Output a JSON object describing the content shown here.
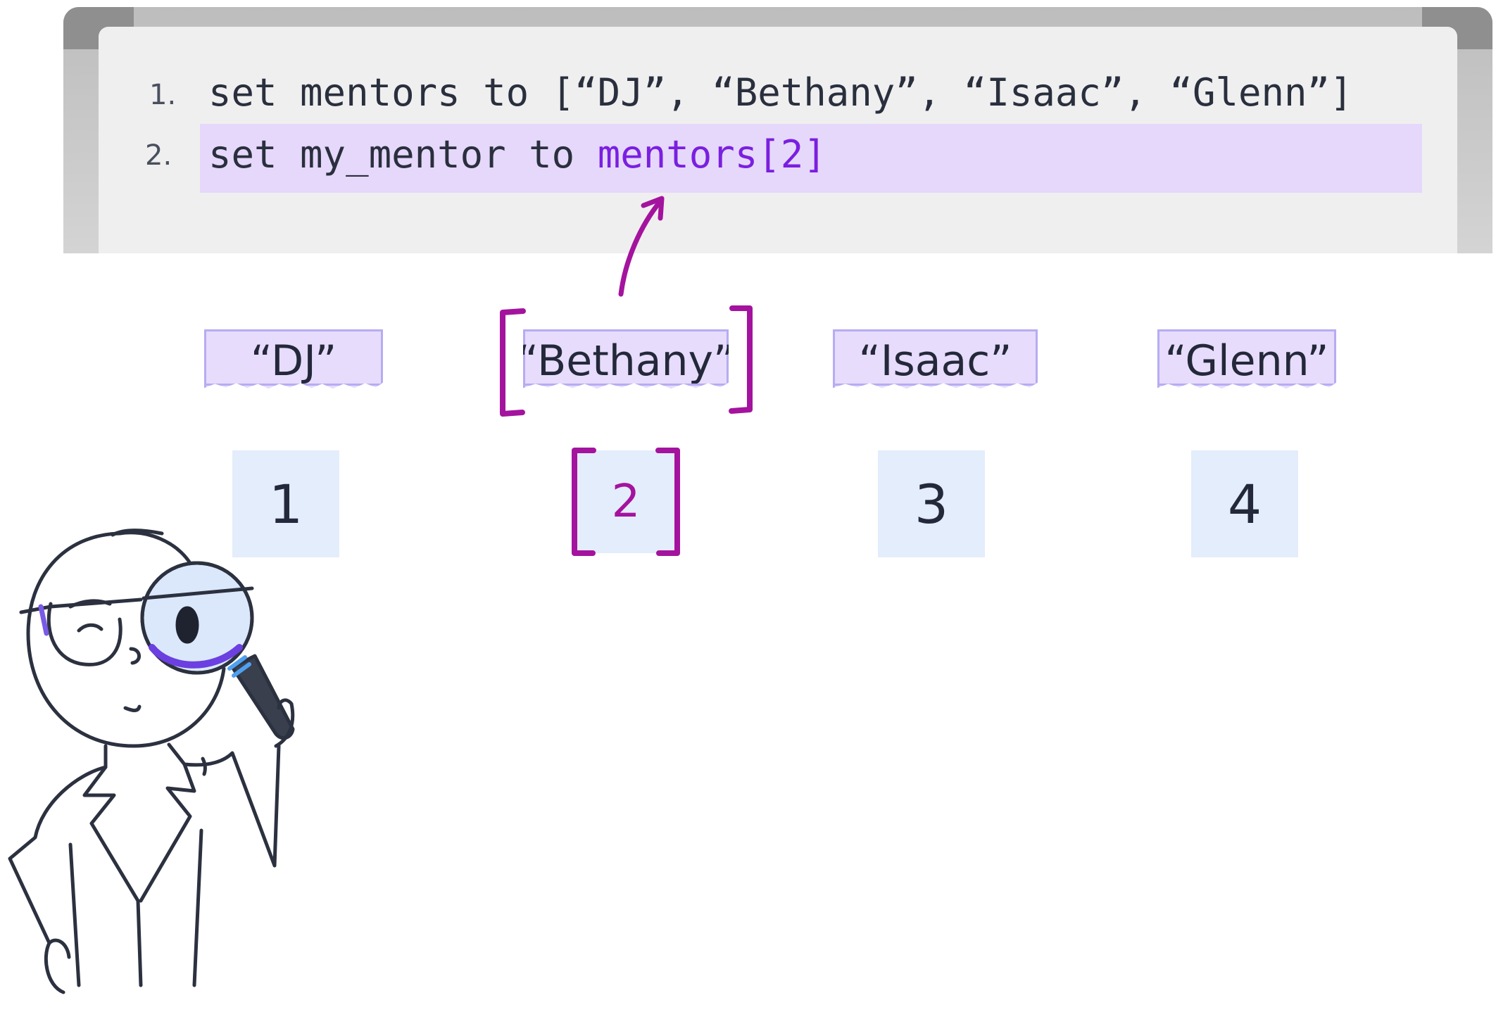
{
  "code": {
    "lines": [
      {
        "number": "1.",
        "text": "set mentors to [“DJ”, “Bethany”, “Isaac”, “Glenn”]"
      },
      {
        "number": "2.",
        "prefix": "set my_mentor to ",
        "highlight": "mentors[2]"
      }
    ]
  },
  "items": [
    {
      "label": "“DJ”",
      "index": "1"
    },
    {
      "label": "“Bethany”",
      "index": "2"
    },
    {
      "label": "“Isaac”",
      "index": "3"
    },
    {
      "label": "“Glenn”",
      "index": "4"
    }
  ],
  "selected_index": 2,
  "colors": {
    "accent_purple": "#7a1fe0",
    "bracket_magenta": "#a4139e",
    "tag_fill": "#e7dcfb",
    "index_fill": "#e3edfb",
    "line_highlight": "#e6d8fa"
  },
  "icons": [
    "scientist-with-magnifying-glass-icon",
    "arrow-up-icon"
  ]
}
